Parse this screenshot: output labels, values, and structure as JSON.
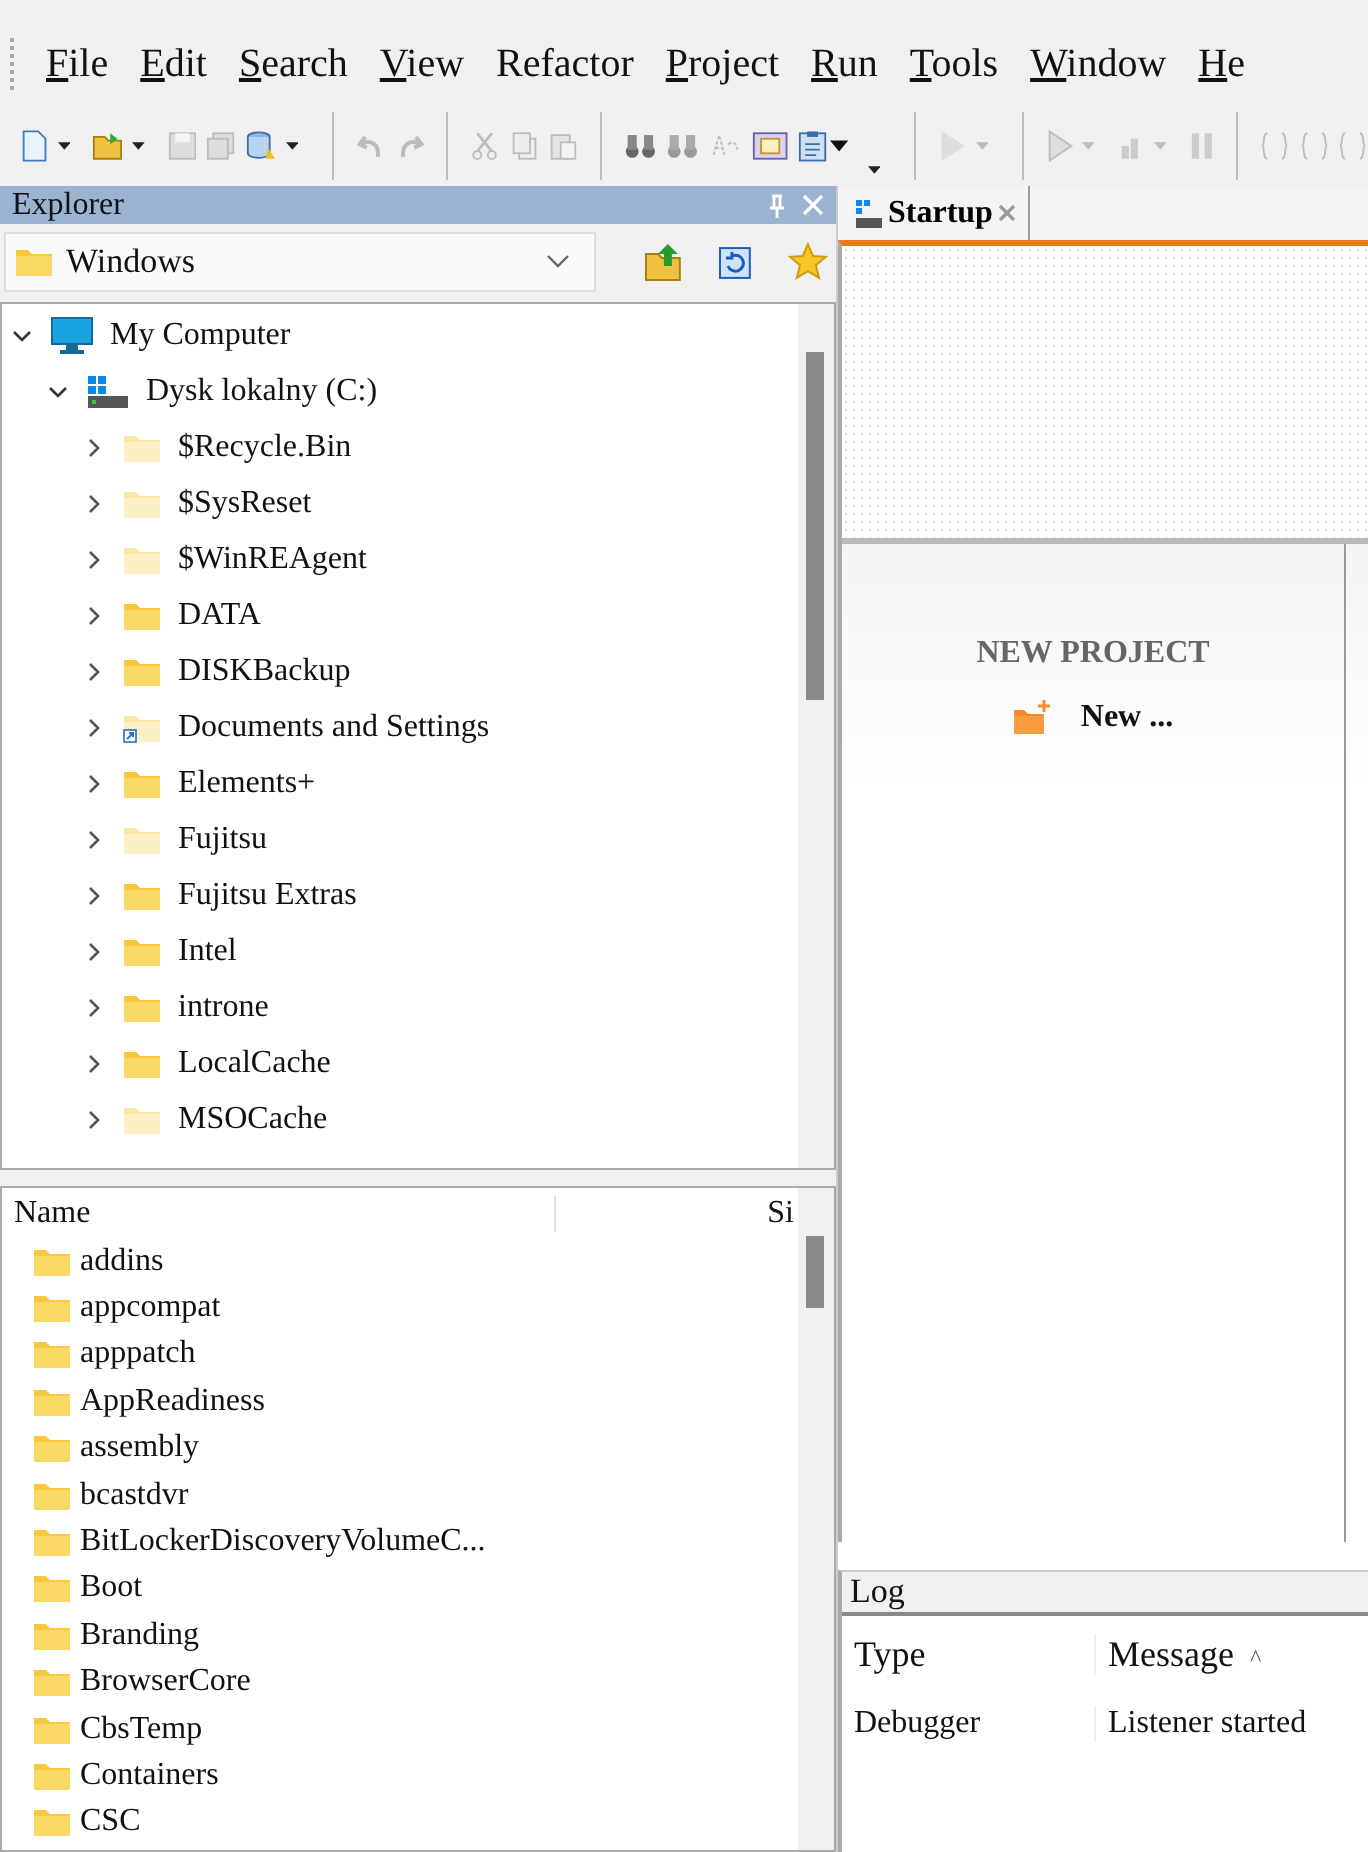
{
  "menu": [
    {
      "label": "File",
      "mnemonic": true
    },
    {
      "label": "Edit",
      "mnemonic": true
    },
    {
      "label": "Search",
      "mnemonic": true
    },
    {
      "label": "View",
      "mnemonic": true
    },
    {
      "label": "Refactor",
      "mnemonic": false
    },
    {
      "label": "Project",
      "mnemonic": true
    },
    {
      "label": "Run",
      "mnemonic": true
    },
    {
      "label": "Tools",
      "mnemonic": true
    },
    {
      "label": "Window",
      "mnemonic": true
    },
    {
      "label": "He",
      "mnemonic": true
    }
  ],
  "explorer": {
    "title": "Explorer",
    "location": "Windows",
    "tree": [
      {
        "label": "My Computer",
        "kind": "computer",
        "expanded": true,
        "children": [
          {
            "label": "Dysk lokalny (C:)",
            "kind": "drive",
            "expanded": true,
            "children": [
              {
                "label": "$Recycle.Bin",
                "kind": "folder",
                "hidden": true,
                "shortcut": false,
                "expanded": false
              },
              {
                "label": "$SysReset",
                "kind": "folder",
                "hidden": true,
                "shortcut": false,
                "expanded": false
              },
              {
                "label": "$WinREAgent",
                "kind": "folder",
                "hidden": true,
                "shortcut": false,
                "expanded": false
              },
              {
                "label": "DATA",
                "kind": "folder",
                "hidden": false,
                "shortcut": false,
                "expanded": false
              },
              {
                "label": "DISKBackup",
                "kind": "folder",
                "hidden": false,
                "shortcut": false,
                "expanded": false
              },
              {
                "label": "Documents and Settings",
                "kind": "folder",
                "hidden": true,
                "shortcut": true,
                "expanded": false
              },
              {
                "label": "Elements+",
                "kind": "folder",
                "hidden": false,
                "shortcut": false,
                "expanded": false
              },
              {
                "label": "Fujitsu",
                "kind": "folder",
                "hidden": true,
                "shortcut": false,
                "expanded": false
              },
              {
                "label": "Fujitsu Extras",
                "kind": "folder",
                "hidden": false,
                "shortcut": false,
                "expanded": false
              },
              {
                "label": "Intel",
                "kind": "folder",
                "hidden": false,
                "shortcut": false,
                "expanded": false
              },
              {
                "label": "introne",
                "kind": "folder",
                "hidden": false,
                "shortcut": false,
                "expanded": false
              },
              {
                "label": "LocalCache",
                "kind": "folder",
                "hidden": false,
                "shortcut": false,
                "expanded": false
              },
              {
                "label": "MSOCache",
                "kind": "folder",
                "hidden": true,
                "shortcut": false,
                "expanded": false
              }
            ]
          }
        ]
      }
    ],
    "files": {
      "columns": [
        "Name",
        "Si"
      ],
      "rows": [
        "addins",
        "appcompat",
        "apppatch",
        "AppReadiness",
        "assembly",
        "bcastdvr",
        "BitLockerDiscoveryVolumeC...",
        "Boot",
        "Branding",
        "BrowserCore",
        "CbsTemp",
        "Containers",
        "CSC"
      ]
    }
  },
  "tabs": [
    {
      "label": "Startup",
      "selected": true
    }
  ],
  "startup": {
    "heading": "NEW PROJECT",
    "items": [
      "New ..."
    ]
  },
  "log": {
    "title": "Log",
    "columns": [
      {
        "label": "Type"
      },
      {
        "label": "Message",
        "sort_indicator": "^"
      }
    ],
    "rows": [
      [
        "Debugger",
        "Listener started"
      ]
    ]
  }
}
